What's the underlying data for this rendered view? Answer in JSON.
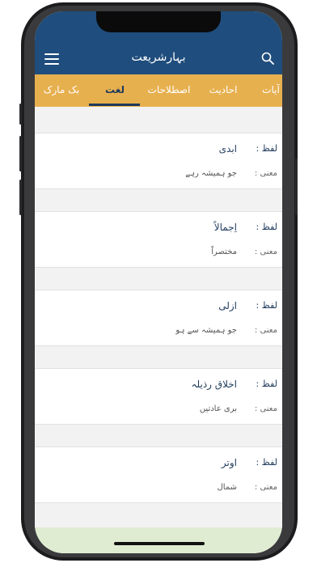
{
  "header": {
    "title": "بہارشریعت",
    "menu_icon": "hamburger-menu-icon",
    "search_icon": "search-icon",
    "background": "#1f4d7d"
  },
  "tabs": {
    "items": [
      {
        "label": "آیات"
      },
      {
        "label": "احادیث"
      },
      {
        "label": "اصطلاحات"
      },
      {
        "label": "لغت",
        "active": true
      },
      {
        "label": "بک مارک"
      }
    ],
    "background": "#e7b04f",
    "active_color": "#1f3a5c"
  },
  "entries": [
    {
      "word_label": "لفظ :",
      "word": "ابدی",
      "meaning_label": "معنی :",
      "meaning": "جو ہمیشہ رہے"
    },
    {
      "word_label": "لفظ :",
      "word": "اِجمالاً",
      "meaning_label": "معنی :",
      "meaning": "مختصراً"
    },
    {
      "word_label": "لفظ :",
      "word": "ازلی",
      "meaning_label": "معنی :",
      "meaning": "جو ہمیشہ سے ہو"
    },
    {
      "word_label": "لفظ :",
      "word": "اخلاق رذیلہ",
      "meaning_label": "معنی :",
      "meaning": "بری عادتیں"
    },
    {
      "word_label": "لفظ :",
      "word": "اوتر",
      "meaning_label": "معنی :",
      "meaning": "شمال"
    }
  ]
}
